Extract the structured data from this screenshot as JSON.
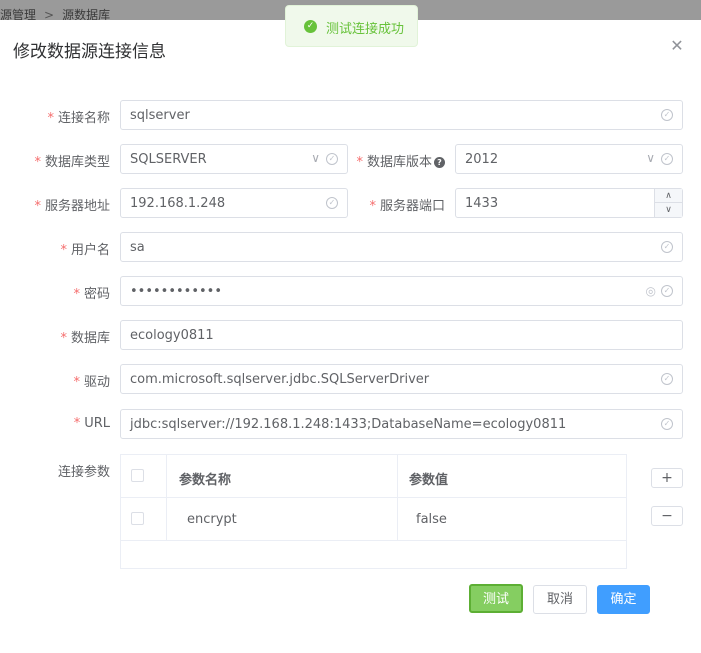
{
  "breadcrumb": {
    "item1": "源管理",
    "separator": ">",
    "item2": "源数据库"
  },
  "toast": {
    "text": "测试连接成功"
  },
  "dialog": {
    "title": "修改数据源连接信息",
    "fields": {
      "conn_name": {
        "label": "连接名称",
        "value": "sqlserver"
      },
      "db_type": {
        "label": "数据库类型",
        "value": "SQLSERVER"
      },
      "db_version": {
        "label": "数据库版本",
        "value": "2012"
      },
      "server_addr": {
        "label": "服务器地址",
        "value": "192.168.1.248"
      },
      "server_port": {
        "label": "服务器端口",
        "value": "1433"
      },
      "username": {
        "label": "用户名",
        "value": "sa"
      },
      "password": {
        "label": "密码",
        "value": "••••••••••••"
      },
      "database": {
        "label": "数据库",
        "value": "ecology0811"
      },
      "driver": {
        "label": "驱动",
        "value": "com.microsoft.sqlserver.jdbc.SQLServerDriver"
      },
      "url": {
        "label": "URL",
        "value": "jdbc:sqlserver://192.168.1.248:1433;DatabaseName=ecology0811"
      }
    },
    "params": {
      "label": "连接参数",
      "columns": [
        "参数名称",
        "参数值"
      ],
      "rows": [
        {
          "name": "encrypt",
          "value": "false"
        }
      ],
      "add": "+",
      "remove": "−"
    },
    "buttons": {
      "test": "测试",
      "cancel": "取消",
      "confirm": "确定"
    }
  },
  "colors": {
    "primary": "#409eff",
    "success": "#67c23a",
    "required": "#f56c6c"
  },
  "icons": [
    "success-icon",
    "close-icon",
    "check-circle-icon",
    "chevron-down-icon",
    "help-icon",
    "eye-slash-icon",
    "step-up-icon",
    "step-down-icon"
  ]
}
